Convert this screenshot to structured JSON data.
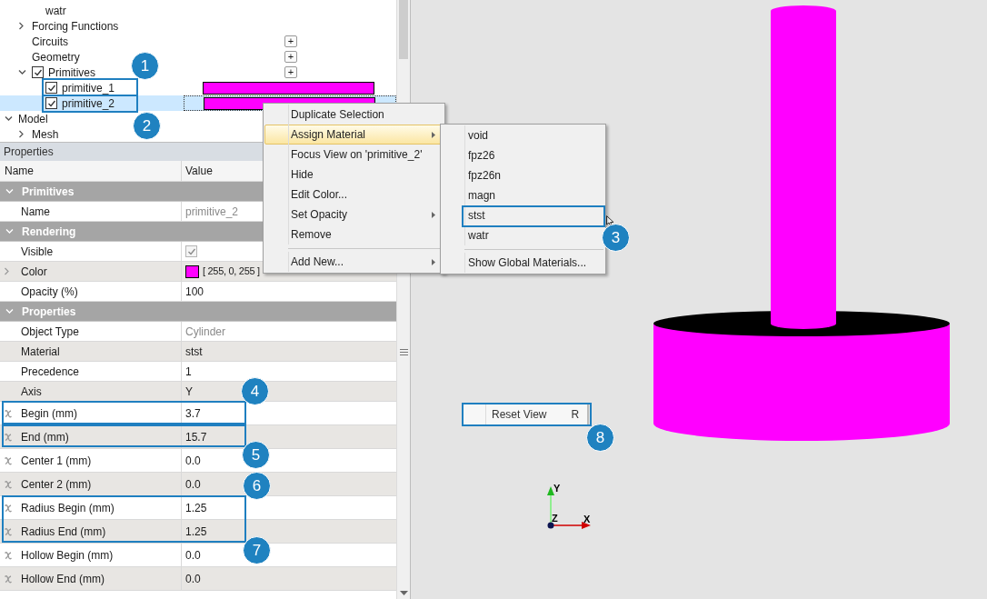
{
  "tree": {
    "items": [
      {
        "children": [
          {
            "children": [
              {
                "label": "watr"
              }
            ]
          },
          {
            "label": "Forcing Functions",
            "expanded": false
          },
          {
            "label": "Circuits",
            "add_button": "+"
          },
          {
            "label": "Geometry",
            "add_button": "+"
          },
          {
            "label": "Primitives",
            "expanded": true,
            "checked": true,
            "add_button": "+",
            "children": [
              {
                "label": "primitive_1",
                "checked": true,
                "selected": false,
                "color": "#ff00ff"
              },
              {
                "label": "primitive_2",
                "checked": true,
                "selected": true,
                "color": "#ff00ff"
              }
            ]
          }
        ]
      },
      {
        "label": "Model",
        "expanded": true,
        "children": [
          {
            "label": "Mesh",
            "expanded": false
          }
        ]
      }
    ]
  },
  "properties": {
    "title": "Properties",
    "columns": [
      "Name",
      "Value"
    ],
    "rows": [
      {
        "kind": "group",
        "label": "Primitives",
        "expanded": true
      },
      {
        "kind": "text",
        "name": "Name",
        "value": "primitive_2",
        "readonly": true
      },
      {
        "kind": "group",
        "label": "Rendering",
        "expanded": true
      },
      {
        "kind": "checkbox",
        "name": "Visible",
        "checked": true
      },
      {
        "kind": "color",
        "name": "Color",
        "expanded": false,
        "color": "#ff00ff",
        "value": "[ 255, 0, 255 ]"
      },
      {
        "kind": "text",
        "name": "Opacity (%)",
        "value": "100"
      },
      {
        "kind": "group",
        "label": "Properties",
        "expanded": true
      },
      {
        "kind": "text",
        "name": "Object Type",
        "value": "Cylinder",
        "readonly": true
      },
      {
        "kind": "text",
        "name": "Material",
        "value": "stst"
      },
      {
        "kind": "text",
        "name": "Precedence",
        "value": "1"
      },
      {
        "kind": "text",
        "name": "Axis",
        "value": "Y"
      },
      {
        "kind": "expression",
        "name": "Begin (mm)",
        "value": "3.7"
      },
      {
        "kind": "expression",
        "name": "End (mm)",
        "value": "15.7"
      },
      {
        "kind": "expression",
        "name": "Center 1 (mm)",
        "value": "0.0"
      },
      {
        "kind": "expression",
        "name": "Center 2 (mm)",
        "value": "0.0"
      },
      {
        "kind": "expression",
        "name": "Radius Begin (mm)",
        "value": "1.25"
      },
      {
        "kind": "expression",
        "name": "Radius End (mm)",
        "value": "1.25"
      },
      {
        "kind": "expression",
        "name": "Hollow Begin (mm)",
        "value": "0.0"
      },
      {
        "kind": "expression",
        "name": "Hollow End (mm)",
        "value": "0.0"
      }
    ]
  },
  "context_menu": {
    "items": [
      {
        "kind": "item",
        "label": "Duplicate Selection",
        "submenu": false,
        "highlighted": false
      },
      {
        "kind": "item",
        "label": "Assign Material",
        "submenu": true,
        "highlighted": true
      },
      {
        "kind": "item",
        "label": "Focus View on 'primitive_2'",
        "submenu": false,
        "highlighted": false
      },
      {
        "kind": "item",
        "label": "Hide",
        "submenu": false,
        "highlighted": false
      },
      {
        "kind": "item",
        "label": "Edit Color...",
        "submenu": false,
        "highlighted": false
      },
      {
        "kind": "item",
        "label": "Set Opacity",
        "submenu": true,
        "highlighted": false
      },
      {
        "kind": "item",
        "label": "Remove",
        "submenu": false,
        "highlighted": false
      },
      {
        "kind": "separator"
      },
      {
        "kind": "item",
        "label": "Add New...",
        "submenu": true,
        "highlighted": false
      }
    ]
  },
  "submenu": {
    "items": [
      {
        "kind": "item",
        "label": "void"
      },
      {
        "kind": "item",
        "label": "fpz26"
      },
      {
        "kind": "item",
        "label": "fpz26n"
      },
      {
        "kind": "item",
        "label": "magn"
      },
      {
        "kind": "item",
        "label": "stst"
      },
      {
        "kind": "item",
        "label": "watr"
      },
      {
        "kind": "separator"
      },
      {
        "kind": "item",
        "label": "Show Global Materials..."
      }
    ]
  },
  "viewport": {
    "menu": {
      "label": "Reset View",
      "shortcut": "R"
    },
    "axes": {
      "y": "Y",
      "z": "Z",
      "x": "X"
    }
  },
  "callouts": [
    {
      "number": "1"
    },
    {
      "number": "2"
    },
    {
      "number": "3"
    },
    {
      "number": "4"
    },
    {
      "number": "5"
    },
    {
      "number": "6"
    },
    {
      "number": "7"
    },
    {
      "number": "8"
    }
  ]
}
